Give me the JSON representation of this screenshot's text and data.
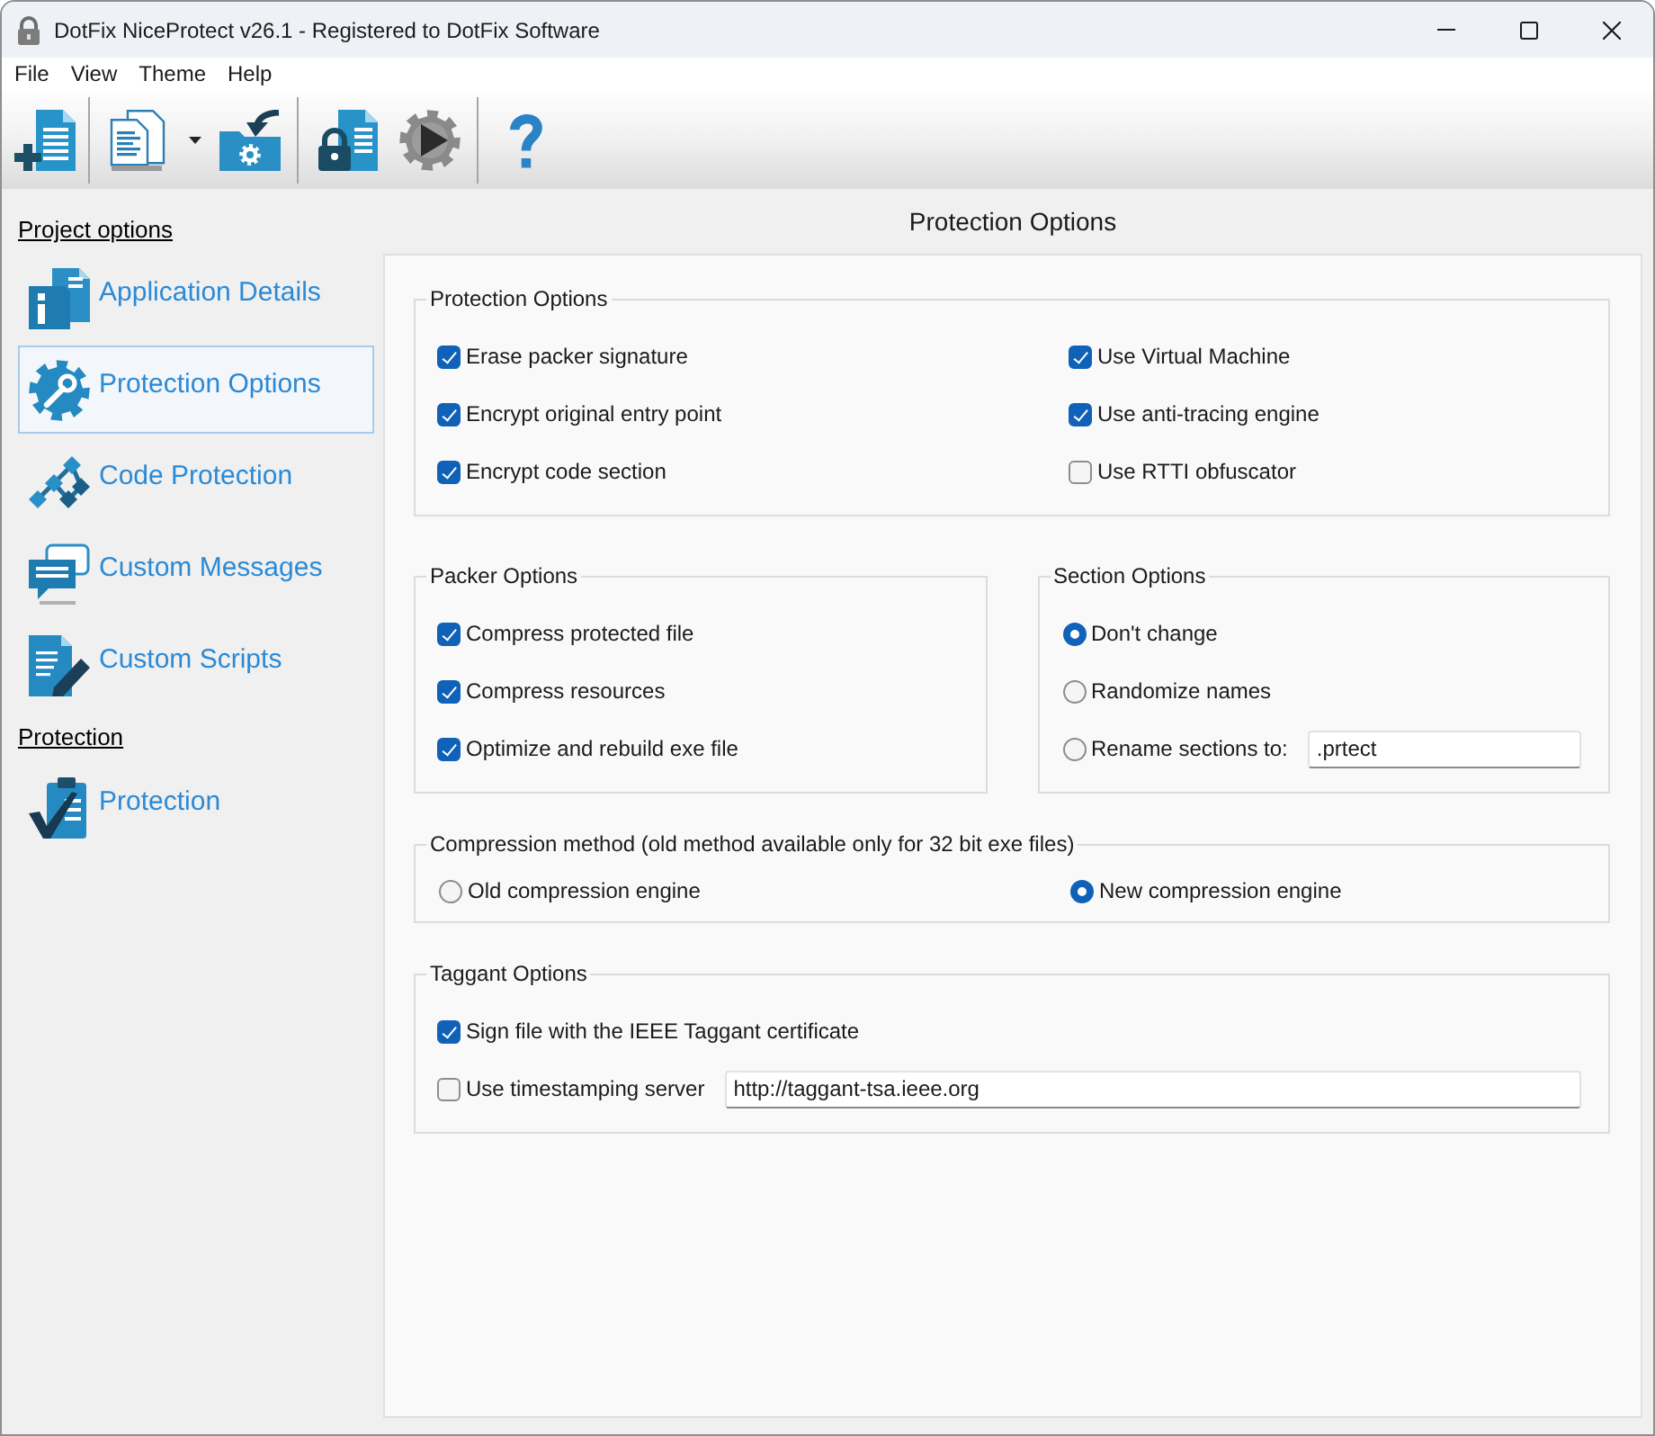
{
  "window": {
    "title": "DotFix NiceProtect v26.1 - Registered to DotFix Software"
  },
  "menu": [
    "File",
    "View",
    "Theme",
    "Help"
  ],
  "sidebar": {
    "sections": [
      {
        "heading": "Project options",
        "items": [
          {
            "label": "Application Details",
            "selected": false
          },
          {
            "label": "Protection Options",
            "selected": true
          },
          {
            "label": "Code Protection",
            "selected": false
          },
          {
            "label": "Custom Messages",
            "selected": false
          },
          {
            "label": "Custom Scripts",
            "selected": false
          }
        ]
      },
      {
        "heading": "Protection",
        "items": [
          {
            "label": "Protection",
            "selected": false
          }
        ]
      }
    ]
  },
  "content": {
    "title": "Protection Options",
    "rows": [
      [
        {
          "title": "Protection Options",
          "columns": [
            [
              {
                "kind": "checkbox",
                "label": "Erase packer signature",
                "checked": true
              },
              {
                "kind": "checkbox",
                "label": "Encrypt original entry point",
                "checked": true
              },
              {
                "kind": "checkbox",
                "label": "Encrypt code section",
                "checked": true
              }
            ],
            [
              {
                "kind": "checkbox",
                "label": "Use Virtual Machine",
                "checked": true
              },
              {
                "kind": "checkbox",
                "label": "Use anti-tracing engine",
                "checked": true
              },
              {
                "kind": "checkbox",
                "label": "Use RTTI obfuscator",
                "checked": false
              }
            ]
          ]
        }
      ],
      [
        {
          "title": "Packer Options",
          "columns": [
            [
              {
                "kind": "checkbox",
                "label": "Compress protected file",
                "checked": true
              },
              {
                "kind": "checkbox",
                "label": "Compress resources",
                "checked": true
              },
              {
                "kind": "checkbox",
                "label": "Optimize and rebuild exe file",
                "checked": true
              }
            ]
          ]
        },
        {
          "title": "Section Options",
          "columns": [
            [
              {
                "kind": "radio",
                "label": "Don't change",
                "selected": true
              },
              {
                "kind": "radio",
                "label": "Randomize names",
                "selected": false
              },
              {
                "kind": "radio",
                "label": "Rename sections to:",
                "selected": false,
                "field": {
                  "value": ".prtect"
                }
              }
            ]
          ]
        }
      ],
      [
        {
          "title": "Compression method (old method available only for 32 bit exe files)",
          "columns": [
            [
              {
                "kind": "radio",
                "label": "Old compression engine",
                "selected": false
              }
            ],
            [
              {
                "kind": "radio",
                "label": "New compression engine",
                "selected": true
              }
            ]
          ]
        }
      ],
      [
        {
          "title": "Taggant Options",
          "columns": [
            [
              {
                "kind": "checkbox",
                "label": "Sign file with the IEEE Taggant certificate",
                "checked": true
              },
              {
                "kind": "checkbox",
                "label": "Use timestamping server",
                "checked": false,
                "field": {
                  "value": "http://taggant-tsa.ieee.org"
                }
              }
            ]
          ]
        }
      ]
    ]
  }
}
